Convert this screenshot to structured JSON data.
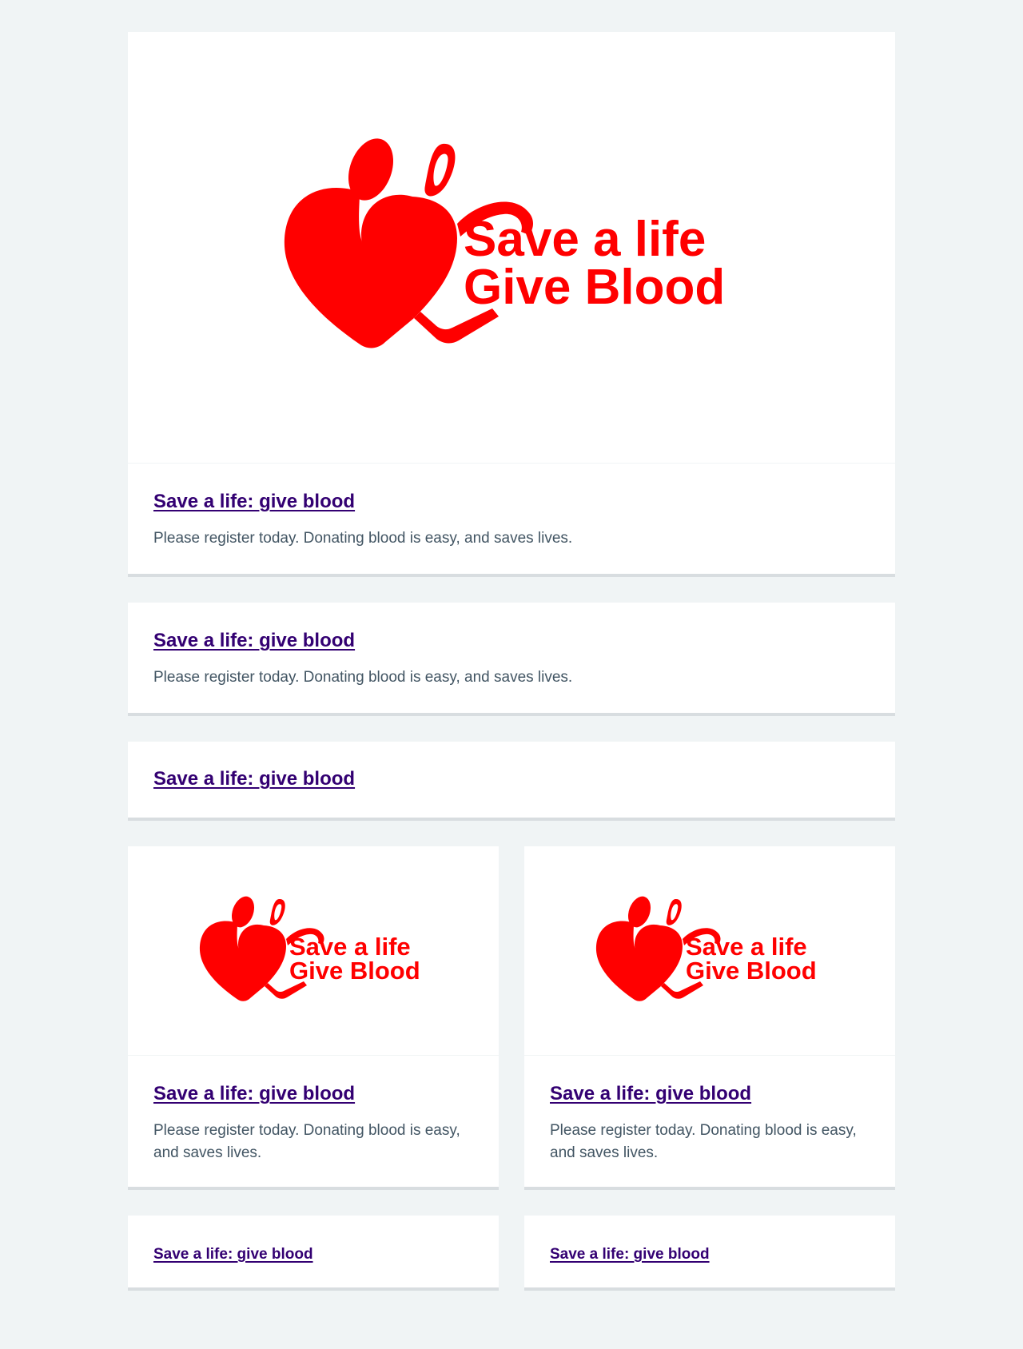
{
  "logo": {
    "line1": "Save a life",
    "line2": "Give Blood",
    "color": "#ff0000"
  },
  "colors": {
    "page_bg": "#f0f4f5",
    "card_bg": "#ffffff",
    "link": "#330072",
    "text": "#425563",
    "card_border": "#d8dde0"
  },
  "cards": [
    {
      "heading": "Save a life: give blood",
      "description": "Please register today. Donating blood is easy, and saves lives."
    },
    {
      "heading": "Save a life: give blood",
      "description": "Please register today. Donating blood is easy, and saves lives."
    },
    {
      "heading": "Save a life: give blood"
    },
    {
      "heading": "Save a life: give blood",
      "description": "Please register today. Donating blood is easy, and saves lives."
    },
    {
      "heading": "Save a life: give blood",
      "description": "Please register today. Donating blood is easy, and saves lives."
    },
    {
      "heading": "Save a life: give blood"
    },
    {
      "heading": "Save a life: give blood"
    }
  ]
}
